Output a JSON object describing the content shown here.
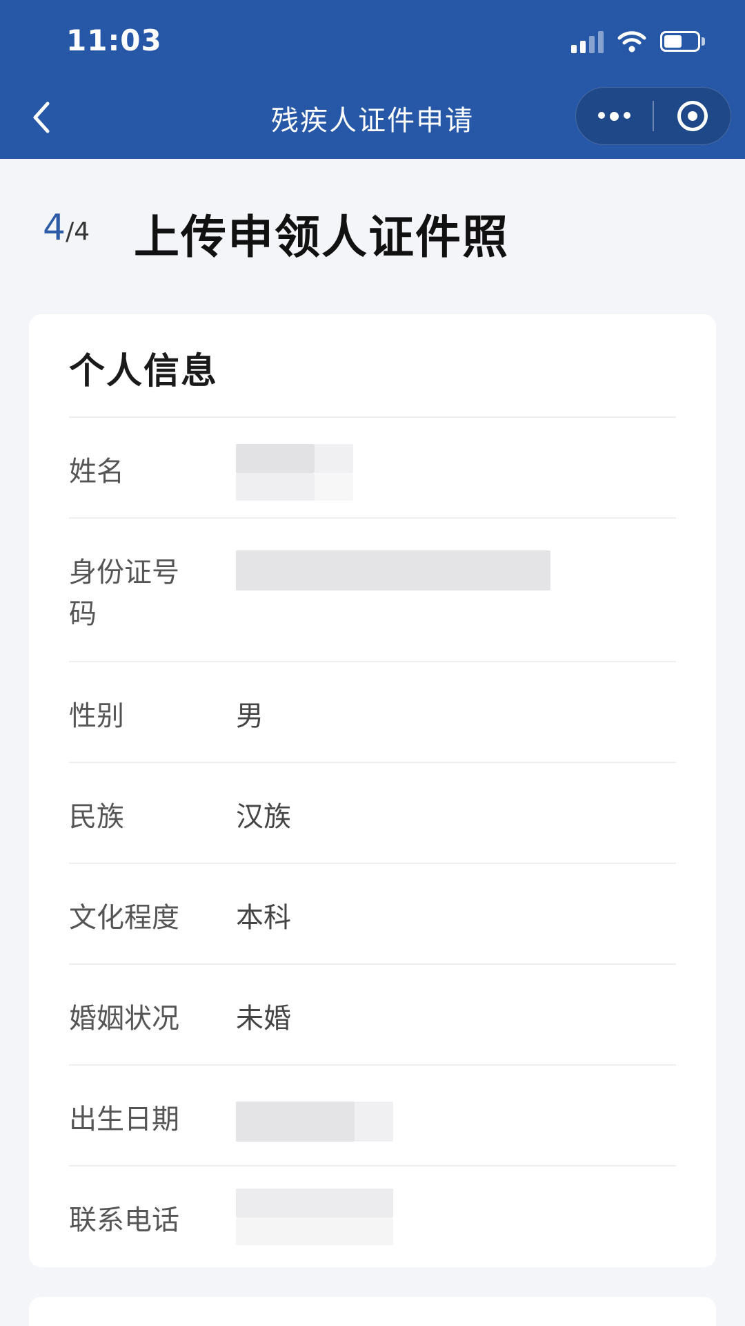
{
  "status_bar": {
    "time": "11:03"
  },
  "nav": {
    "title": "残疾人证件申请"
  },
  "step": {
    "current": "4",
    "total": "/4",
    "title": "上传申领人证件照"
  },
  "personal_info": {
    "title": "个人信息",
    "rows": [
      {
        "label": "姓名",
        "value": ""
      },
      {
        "label": "身份证号码",
        "value": ""
      },
      {
        "label": "性别",
        "value": "男"
      },
      {
        "label": "民族",
        "value": "汉族"
      },
      {
        "label": "文化程度",
        "value": "本科"
      },
      {
        "label": "婚姻状况",
        "value": "未婚"
      },
      {
        "label": "出生日期",
        "value": ""
      },
      {
        "label": "联系电话",
        "value": ""
      }
    ]
  },
  "colors": {
    "header_bg": "#2758a8",
    "accent": "#2e5ba5",
    "page_bg": "#f3f5f9"
  },
  "icons": [
    "back-chevron-icon",
    "more-dots-icon",
    "close-target-icon",
    "signal-icon",
    "wifi-icon",
    "battery-icon"
  ]
}
